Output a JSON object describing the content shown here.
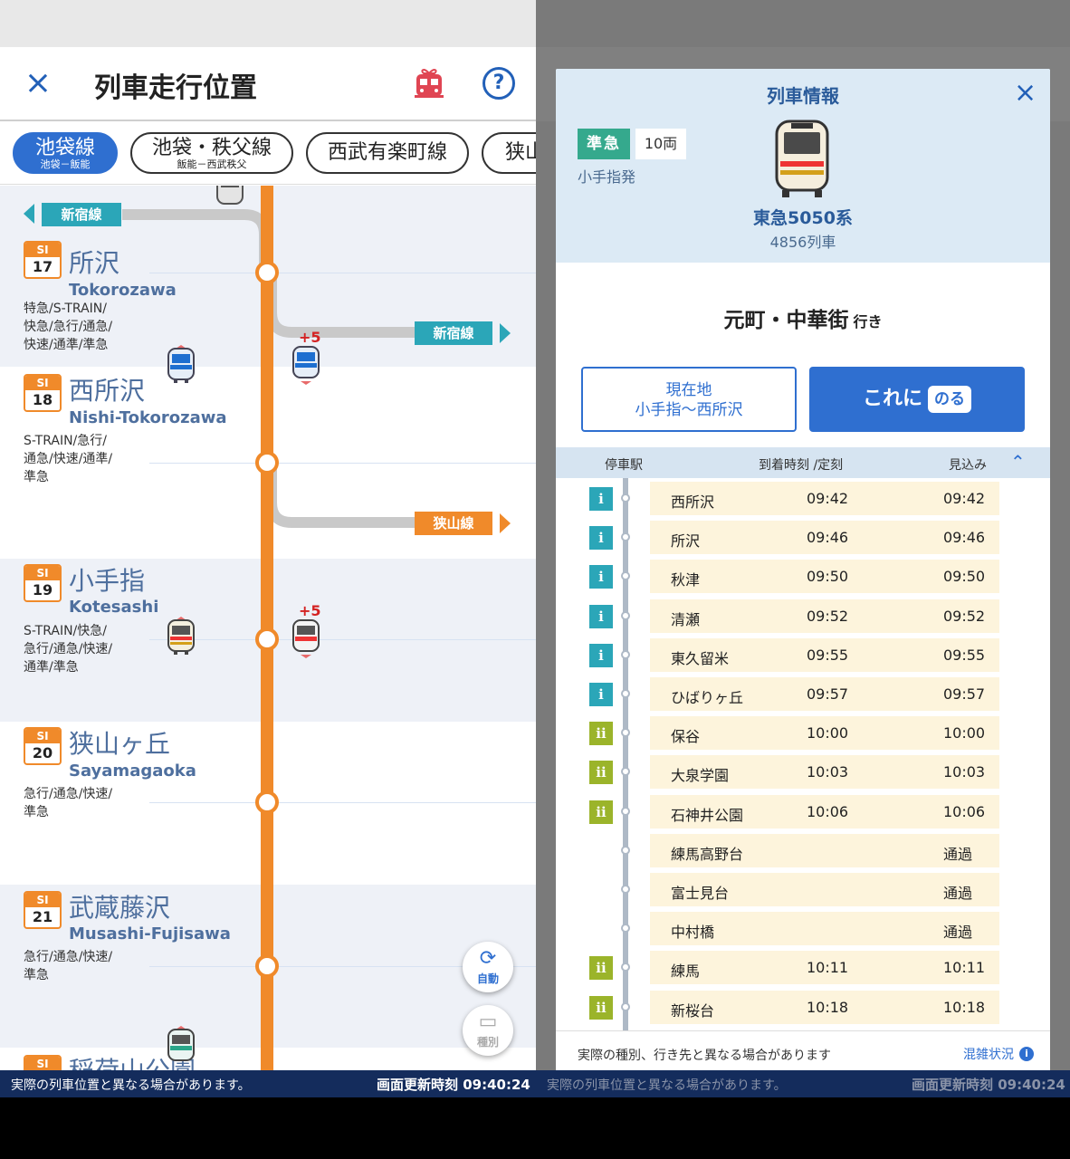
{
  "header": {
    "title": "列車走行位置",
    "close_label": "×",
    "help_label": "?"
  },
  "tabs": [
    {
      "label": "池袋線",
      "sub": "池袋－飯能",
      "active": true
    },
    {
      "label": "池袋・秩父線",
      "sub": "飯能－西武秩父",
      "active": false
    },
    {
      "label": "西武有楽町線",
      "sub": "",
      "active": false
    },
    {
      "label": "狭山",
      "sub": "",
      "active": false
    }
  ],
  "branches": {
    "shinjuku_top": "新宿線",
    "shinjuku_mid": "新宿線",
    "sayama": "狭山線"
  },
  "stations": [
    {
      "code": "SI",
      "num": "17",
      "jp": "所沢",
      "en": "Tokorozawa",
      "types": "特急/S-TRAIN/\n快急/急行/通急/\n快速/通準/準急"
    },
    {
      "code": "SI",
      "num": "18",
      "jp": "西所沢",
      "en": "Nishi-Tokorozawa",
      "types": "S-TRAIN/急行/\n通急/快速/通準/\n準急"
    },
    {
      "code": "SI",
      "num": "19",
      "jp": "小手指",
      "en": "Kotesashi",
      "types": "S-TRAIN/快急/\n急行/通急/快速/\n通準/準急"
    },
    {
      "code": "SI",
      "num": "20",
      "jp": "狭山ヶ丘",
      "en": "Sayamagaoka",
      "types": "急行/通急/快速/\n準急"
    },
    {
      "code": "SI",
      "num": "21",
      "jp": "武蔵藤沢",
      "en": "Musashi-Fujisawa",
      "types": "急行/通急/快速/\n準急"
    },
    {
      "code": "SI",
      "num": "",
      "jp": "稲荷山公園",
      "en": "",
      "types": ""
    }
  ],
  "delays": {
    "d1": "+5",
    "d2": "+5"
  },
  "fabs": {
    "auto": "自動",
    "kind": "種別"
  },
  "footer": {
    "notice": "実際の列車位置と異なる場合があります。",
    "updated": "画面更新時刻 09:40:24"
  },
  "modal": {
    "title": "列車情報",
    "close_label": "×",
    "kind": "準急",
    "cars": "10両",
    "origin": "小手指発",
    "train_name": "東急5050系",
    "train_no": "4856列車",
    "destination": "元町・中華街",
    "dest_suffix": "行き",
    "loc_button_line1": "現在地",
    "loc_button_line2": "小手指〜西所沢",
    "ride_button": "これに",
    "ride_badge": "のる",
    "col_station": "停車駅",
    "col_arrival": "到着時刻 /定刻",
    "col_expected": "見込み",
    "rows": [
      {
        "info": "i",
        "station": "西所沢",
        "arrival": "09:42",
        "expected": "09:42"
      },
      {
        "info": "i",
        "station": "所沢",
        "arrival": "09:46",
        "expected": "09:46"
      },
      {
        "info": "i",
        "station": "秋津",
        "arrival": "09:50",
        "expected": "09:50"
      },
      {
        "info": "i",
        "station": "清瀬",
        "arrival": "09:52",
        "expected": "09:52"
      },
      {
        "info": "i",
        "station": "東久留米",
        "arrival": "09:55",
        "expected": "09:55"
      },
      {
        "info": "i",
        "station": "ひばりヶ丘",
        "arrival": "09:57",
        "expected": "09:57"
      },
      {
        "info": "ii",
        "station": "保谷",
        "arrival": "10:00",
        "expected": "10:00"
      },
      {
        "info": "ii",
        "station": "大泉学園",
        "arrival": "10:03",
        "expected": "10:03"
      },
      {
        "info": "ii",
        "station": "石神井公園",
        "arrival": "10:06",
        "expected": "10:06"
      },
      {
        "info": "",
        "station": "練馬高野台",
        "arrival": "",
        "expected": "通過"
      },
      {
        "info": "",
        "station": "富士見台",
        "arrival": "",
        "expected": "通過"
      },
      {
        "info": "",
        "station": "中村橋",
        "arrival": "",
        "expected": "通過"
      },
      {
        "info": "ii",
        "station": "練馬",
        "arrival": "10:11",
        "expected": "10:11"
      },
      {
        "info": "ii",
        "station": "新桜台",
        "arrival": "10:18",
        "expected": "10:18"
      }
    ],
    "note": "実際の種別、行き先と異なる場合があります",
    "crowd_link": "混雑状況",
    "crowd_icon": "i"
  },
  "colors": {
    "line_orange": "#f08a2a",
    "accent_blue": "#2f6fd0",
    "teal": "#2ba6b8",
    "kind_green": "#35a98d"
  }
}
